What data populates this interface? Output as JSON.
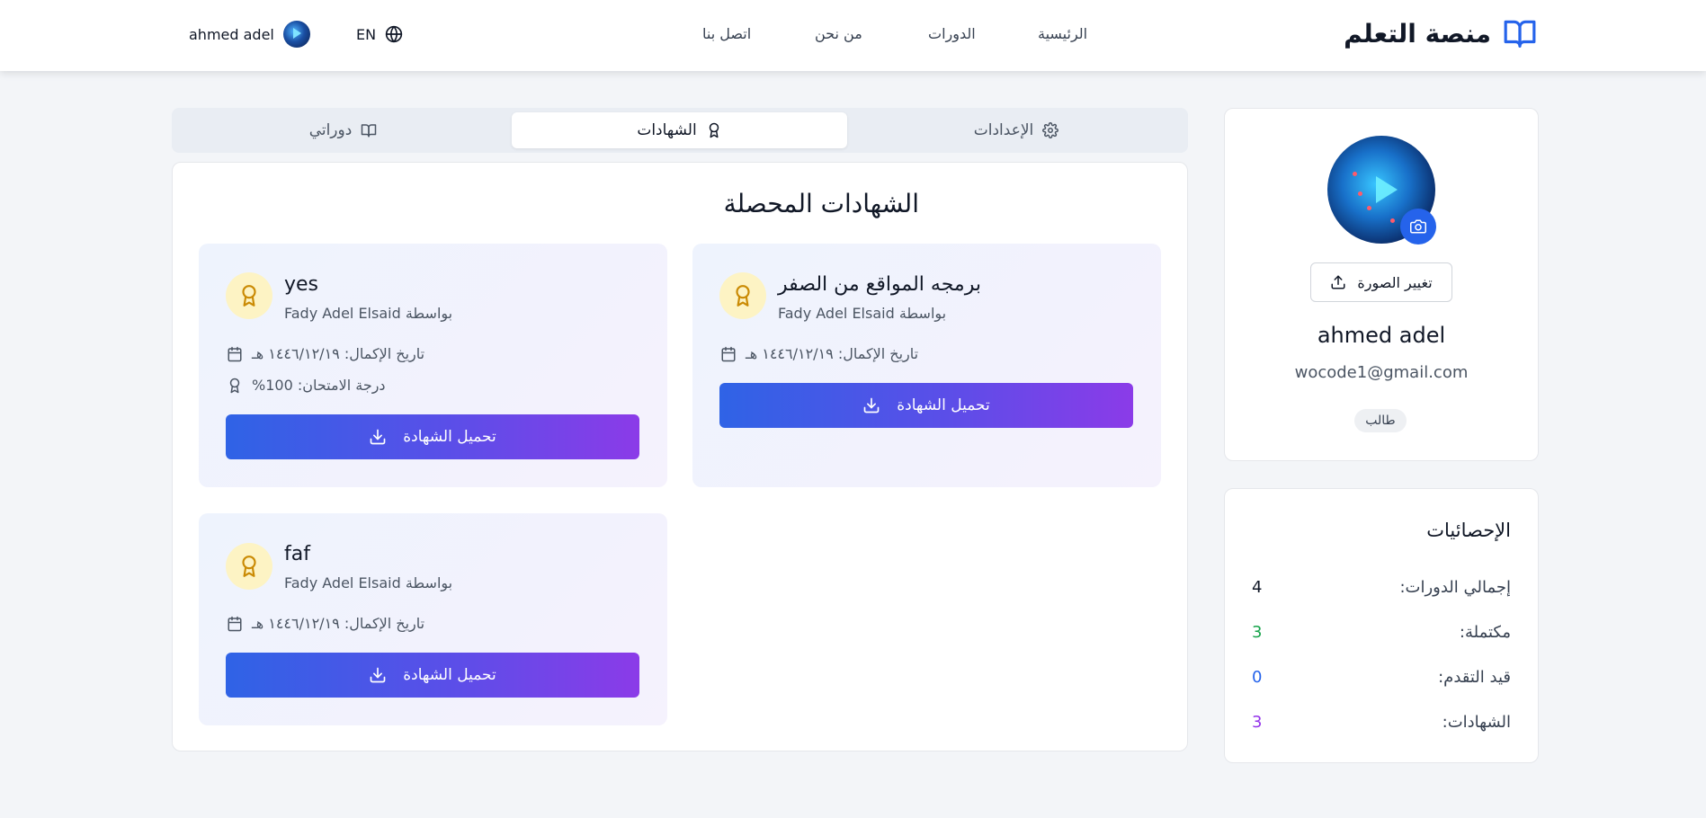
{
  "header": {
    "brand": "منصة التعلم",
    "nav": [
      "الرئيسية",
      "الدورات",
      "من نحن",
      "اتصل بنا"
    ],
    "language": "EN",
    "user_name": "ahmed adel"
  },
  "tabs": [
    {
      "label": "الإعدادات",
      "icon": "gear-icon",
      "active": false
    },
    {
      "label": "الشهادات",
      "icon": "award-icon",
      "active": true
    },
    {
      "label": "دوراتي",
      "icon": "book-open-icon",
      "active": false
    }
  ],
  "main": {
    "title": "الشهادات المحصلة",
    "certificates": [
      {
        "title": "برمجه المواقع من الصفر",
        "by": "بواسطة Fady Adel Elsaid",
        "completion": "تاريخ الإكمال: ١٤٤٦/١٢/١٩ هـ",
        "download": "تحميل الشهادة"
      },
      {
        "title": "yes",
        "by": "بواسطة Fady Adel Elsaid",
        "completion": "تاريخ الإكمال: ١٤٤٦/١٢/١٩ هـ",
        "exam_score": "درجة الامتحان: 100%",
        "download": "تحميل الشهادة"
      },
      {
        "title": "faf",
        "by": "بواسطة Fady Adel Elsaid",
        "completion": "تاريخ الإكمال: ١٤٤٦/١٢/١٩ هـ",
        "download": "تحميل الشهادة"
      }
    ]
  },
  "profile": {
    "change_photo": "تغيير الصورة",
    "name": "ahmed adel",
    "email": "wocode1@gmail.com",
    "role": "طالب"
  },
  "stats": {
    "title": "الإحصائيات",
    "items": [
      {
        "label": "إجمالي الدورات:",
        "value": "4",
        "color": "#111827"
      },
      {
        "label": "مكتملة:",
        "value": "3",
        "color": "#16a34a"
      },
      {
        "label": "قيد التقدم:",
        "value": "0",
        "color": "#2563eb"
      },
      {
        "label": "الشهادات:",
        "value": "3",
        "color": "#9333ea"
      }
    ]
  },
  "colors": {
    "accent": "#2563eb",
    "gradient_end": "#8b3be8",
    "medal_bg": "#fdf3c4",
    "medal_stroke": "#ca8a04"
  }
}
